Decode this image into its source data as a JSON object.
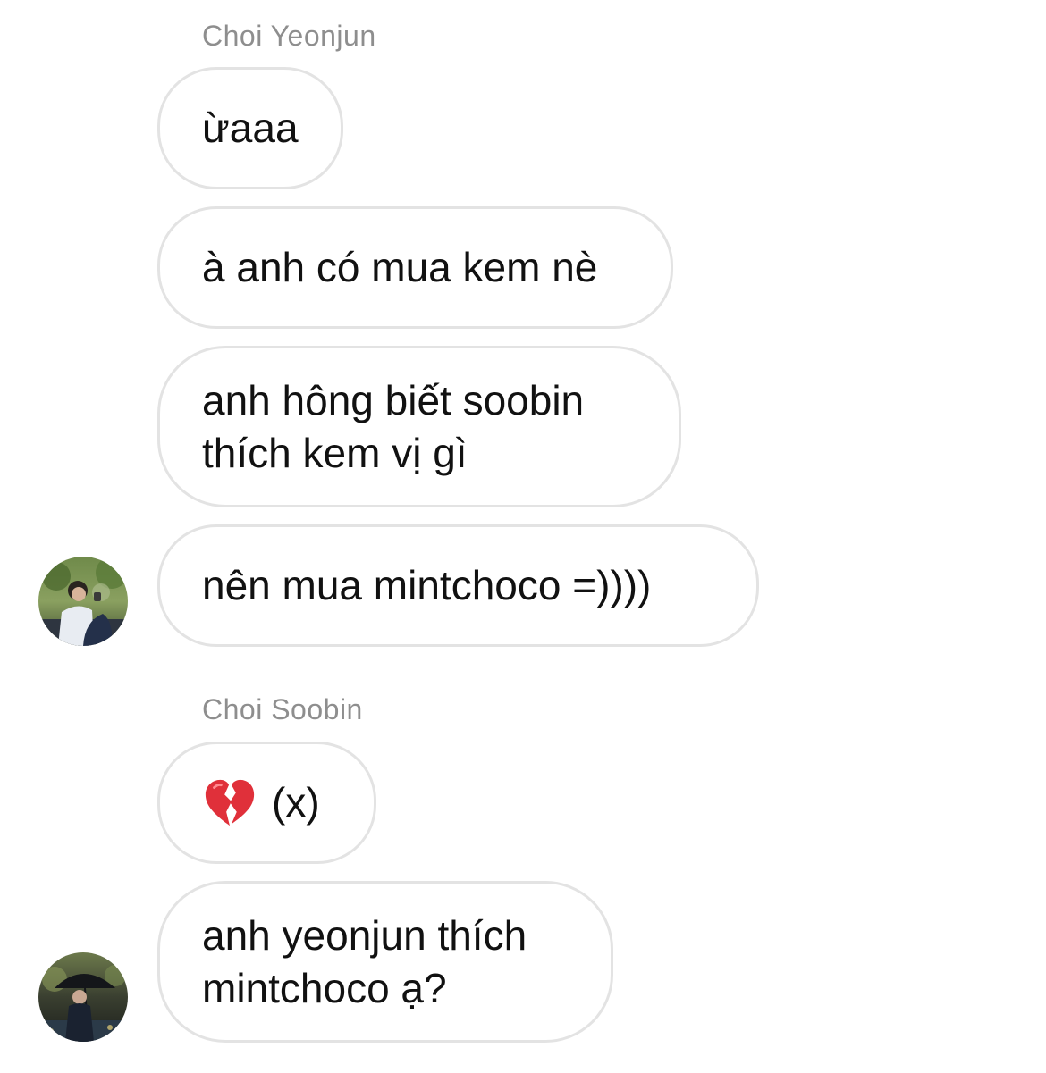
{
  "thread": {
    "groups": [
      {
        "sender": "Choi Yeonjun",
        "messages": [
          "ừaaa",
          "à anh có mua kem nè",
          "anh hông biết soobin\nthích kem vị gì",
          "nên mua mintchoco =))))"
        ],
        "avatar_icon": "avatar-yeonjun"
      },
      {
        "sender": "Choi Soobin",
        "messages": [
          {
            "icon": "broken-heart-emoji",
            "text": "(x)"
          },
          "anh yeonjun thích\nmintchoco ạ?"
        ],
        "avatar_icon": "avatar-soobin"
      }
    ]
  },
  "colors": {
    "bubble_border": "#e3e3e3",
    "sender_name": "#8e8e8e",
    "text": "#111111",
    "broken_heart": "#e0303a"
  }
}
